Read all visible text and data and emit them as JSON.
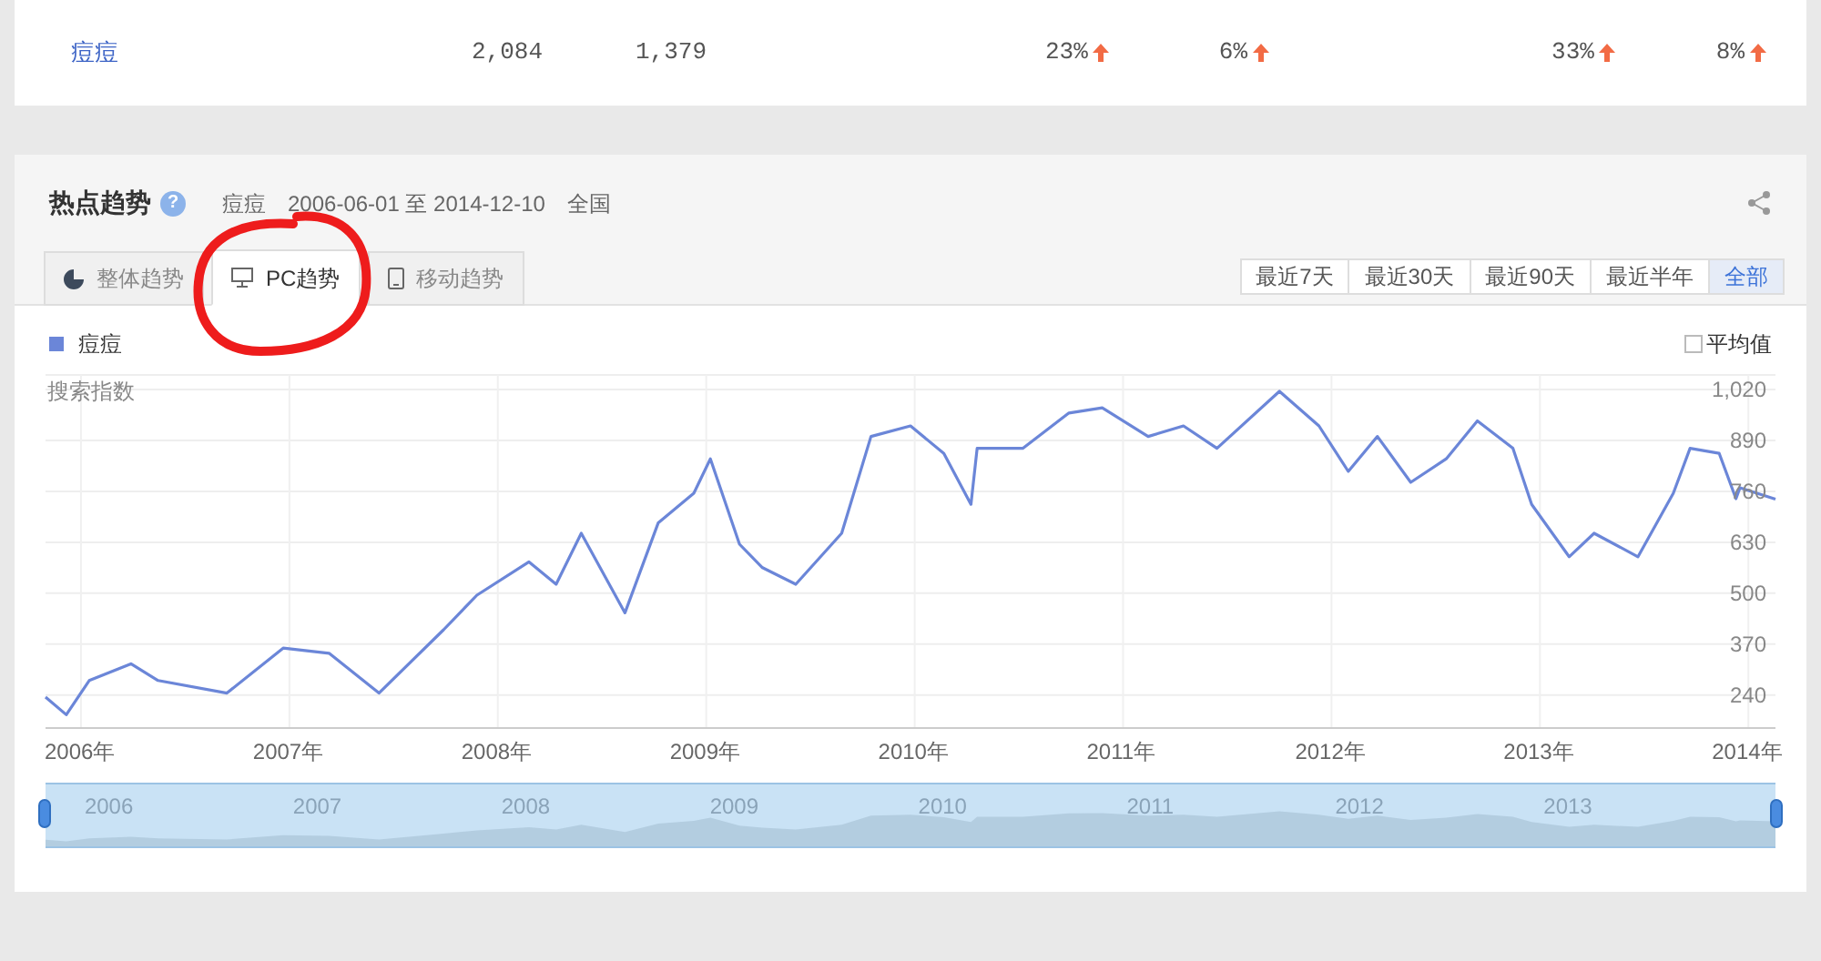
{
  "summary_row": {
    "keyword": "痘痘",
    "cells": [
      "2,084",
      "1,379"
    ],
    "changes": [
      {
        "text": "23%",
        "kind": "up"
      },
      {
        "text": "6%",
        "kind": "up"
      },
      {
        "text": "33%",
        "kind": "up"
      },
      {
        "text": "8%",
        "kind": "up"
      }
    ]
  },
  "trend": {
    "title": "热点趋势",
    "help_icon": "?",
    "keyword": "痘痘",
    "date_range": "2006-06-01 至 2014-12-10",
    "region": "全国",
    "tabs": [
      {
        "label": "整体趋势",
        "kind": "pie",
        "selected": false
      },
      {
        "label": "PC趋势",
        "kind": "monitor",
        "selected": true
      },
      {
        "label": "移动趋势",
        "kind": "phone",
        "selected": false
      }
    ],
    "ranges": [
      {
        "label": "最近7天",
        "selected": false
      },
      {
        "label": "最近30天",
        "selected": false
      },
      {
        "label": "最近90天",
        "selected": false
      },
      {
        "label": "最近半年",
        "selected": false
      },
      {
        "label": "全部",
        "selected": true
      }
    ],
    "average": {
      "label": "平均值",
      "checked": false
    },
    "chart_data": {
      "type": "line",
      "grid": true,
      "ylabel": "搜索指数",
      "xlim": [
        2005.83,
        2014.13
      ],
      "ylim": [
        156,
        1057
      ],
      "x": [
        2005.83,
        2005.93,
        2006.04,
        2006.24,
        2006.37,
        2006.7,
        2006.97,
        2007.19,
        2007.43,
        2007.74,
        2007.9,
        2008.15,
        2008.28,
        2008.4,
        2008.61,
        2008.77,
        2008.94,
        2009.02,
        2009.16,
        2009.27,
        2009.43,
        2009.65,
        2009.79,
        2009.98,
        2010.14,
        2010.27,
        2010.3,
        2010.52,
        2010.74,
        2010.9,
        2011.12,
        2011.29,
        2011.45,
        2011.75,
        2011.94,
        2012.08,
        2012.22,
        2012.38,
        2012.55,
        2012.7,
        2012.87,
        2012.96,
        2013.14,
        2013.26,
        2013.47,
        2013.64,
        2013.72,
        2013.86,
        2013.94,
        2013.96,
        2014.13
      ],
      "series": [
        {
          "name": "痘痘",
          "color": "#6b86d8",
          "values": [
            235,
            190,
            277,
            320,
            277,
            245,
            360,
            347,
            245,
            407,
            495,
            580,
            523,
            653,
            450,
            680,
            755,
            843,
            625,
            565,
            523,
            653,
            900,
            927,
            857,
            727,
            870,
            870,
            960,
            973,
            900,
            927,
            870,
            1015,
            927,
            811,
            900,
            783,
            843,
            940,
            870,
            727,
            593,
            653,
            593,
            755,
            870,
            857,
            741,
            769,
            740
          ]
        }
      ],
      "xticks": [
        {
          "value": 2006,
          "label": "2006年"
        },
        {
          "value": 2007,
          "label": "2007年"
        },
        {
          "value": 2008,
          "label": "2008年"
        },
        {
          "value": 2009,
          "label": "2009年"
        },
        {
          "value": 2010,
          "label": "2010年"
        },
        {
          "value": 2011,
          "label": "2011年"
        },
        {
          "value": 2012,
          "label": "2012年"
        },
        {
          "value": 2013,
          "label": "2013年"
        },
        {
          "value": 2014,
          "label": "2014年"
        }
      ],
      "yticks": [
        240,
        370,
        500,
        630,
        {
          "value": 760,
          "label": "760"
        },
        {
          "value": 890,
          "label": "890"
        },
        {
          "value": 1020,
          "label": "1,020"
        }
      ]
    },
    "navigator_labels": [
      "2006",
      "2007",
      "2008",
      "2009",
      "2010",
      "2011",
      "2012",
      "2013"
    ]
  }
}
